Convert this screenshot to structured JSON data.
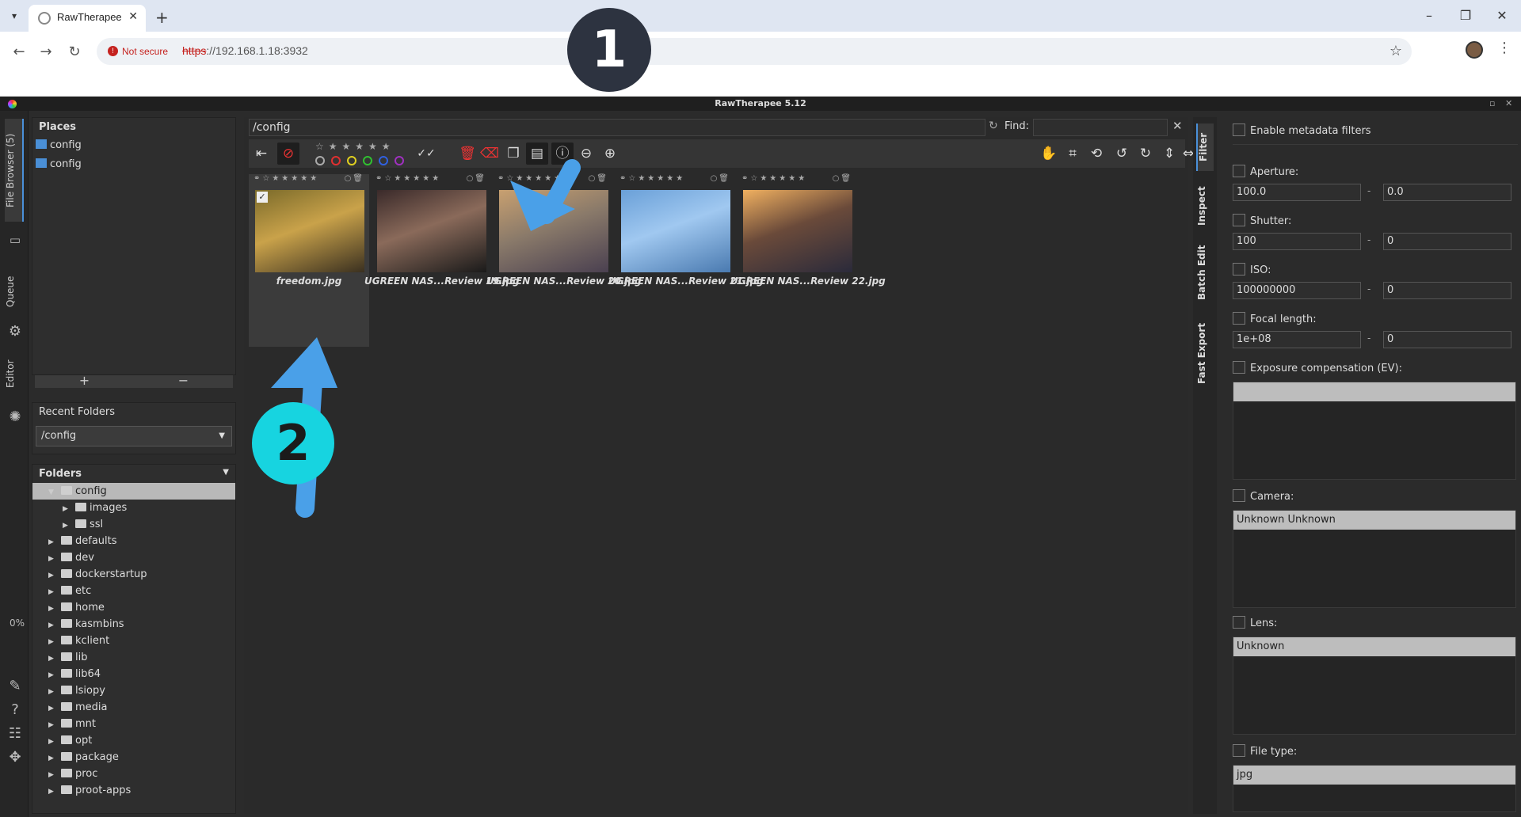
{
  "browser": {
    "tab_title": "RawTherapee",
    "security_label": "Not secure",
    "url_scheme": "https",
    "url_rest": "://192.168.1.18:3932"
  },
  "app": {
    "title": "RawTherapee 5.12"
  },
  "left_tabs": {
    "file_browser": "File Browser (5)",
    "queue": "Queue",
    "editor": "Editor",
    "progress": "0%"
  },
  "places": {
    "heading": "Places",
    "items": [
      "config",
      "config"
    ]
  },
  "recent": {
    "heading": "Recent Folders",
    "selected": "/config"
  },
  "folders": {
    "heading": "Folders",
    "items": [
      {
        "label": "config",
        "depth": 1,
        "open": true,
        "selected": true
      },
      {
        "label": "images",
        "depth": 2
      },
      {
        "label": "ssl",
        "depth": 2
      },
      {
        "label": "defaults",
        "depth": 1
      },
      {
        "label": "dev",
        "depth": 1
      },
      {
        "label": "dockerstartup",
        "depth": 1
      },
      {
        "label": "etc",
        "depth": 1
      },
      {
        "label": "home",
        "depth": 1
      },
      {
        "label": "kasmbins",
        "depth": 1
      },
      {
        "label": "kclient",
        "depth": 1
      },
      {
        "label": "lib",
        "depth": 1
      },
      {
        "label": "lib64",
        "depth": 1
      },
      {
        "label": "lsiopy",
        "depth": 1
      },
      {
        "label": "media",
        "depth": 1
      },
      {
        "label": "mnt",
        "depth": 1
      },
      {
        "label": "opt",
        "depth": 1
      },
      {
        "label": "package",
        "depth": 1
      },
      {
        "label": "proc",
        "depth": 1
      },
      {
        "label": "proot-apps",
        "depth": 1
      }
    ]
  },
  "browser_area": {
    "path": "/config",
    "find_label": "Find:"
  },
  "thumbnails": [
    {
      "name": "freedom.jpg",
      "selected": true,
      "colors": [
        "#7a6a2a",
        "#c9a24a",
        "#3a3020"
      ]
    },
    {
      "name": "UGREEN NAS...Review 19.jpg",
      "selected": false,
      "colors": [
        "#3a2a2a",
        "#8a6a5a",
        "#1a1a1a"
      ]
    },
    {
      "name": "UGREEN NAS...Review 20.jpg",
      "selected": false,
      "colors": [
        "#c8a070",
        "#8a7a6a",
        "#4a4050"
      ]
    },
    {
      "name": "UGREEN NAS...Review 21.jpg",
      "selected": false,
      "colors": [
        "#6aa0d8",
        "#a0c8f0",
        "#4a7ab0"
      ]
    },
    {
      "name": "UGREEN NAS...Review 22.jpg",
      "selected": false,
      "colors": [
        "#f0b060",
        "#6a4a3a",
        "#2a2a3a"
      ]
    }
  ],
  "right_tabs": [
    "Filter",
    "Inspect",
    "Batch Edit",
    "Fast Export"
  ],
  "filters": {
    "enable_meta": "Enable metadata filters",
    "aperture": {
      "label": "Aperture:",
      "from": "100.0",
      "to": "0.0"
    },
    "shutter": {
      "label": "Shutter:",
      "from": "100",
      "to": "0"
    },
    "iso": {
      "label": "ISO:",
      "from": "100000000",
      "to": "0"
    },
    "focal": {
      "label": "Focal length:",
      "from": "1e+08",
      "to": "0"
    },
    "exposure": {
      "label": "Exposure compensation (EV):"
    },
    "camera": {
      "label": "Camera:",
      "item": "Unknown Unknown"
    },
    "lens": {
      "label": "Lens:",
      "item": "Unknown"
    },
    "filetype": {
      "label": "File type:",
      "item": "jpg"
    }
  },
  "annotations": {
    "callout1": "1",
    "callout2": "2",
    "color1": "#2d3340",
    "color2": "#17d4e0"
  }
}
